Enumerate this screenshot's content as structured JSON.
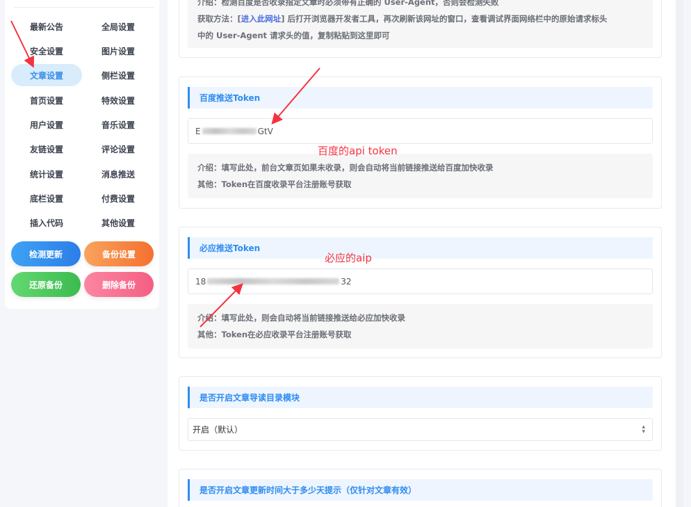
{
  "sidebar": {
    "items": [
      {
        "label": "最新公告"
      },
      {
        "label": "全局设置"
      },
      {
        "label": "安全设置"
      },
      {
        "label": "图片设置"
      },
      {
        "label": "文章设置",
        "active": true
      },
      {
        "label": "侧栏设置"
      },
      {
        "label": "首页设置"
      },
      {
        "label": "特效设置"
      },
      {
        "label": "用户设置"
      },
      {
        "label": "音乐设置"
      },
      {
        "label": "友链设置"
      },
      {
        "label": "评论设置"
      },
      {
        "label": "统计设置"
      },
      {
        "label": "消息推送"
      },
      {
        "label": "底栏设置"
      },
      {
        "label": "付费设置"
      },
      {
        "label": "插入代码"
      },
      {
        "label": "其他设置"
      }
    ],
    "buttons": {
      "check_update": "检测更新",
      "backup": "备份设置",
      "restore": "还原备份",
      "delete_backup": "删除备份"
    }
  },
  "top_card": {
    "intro": "介绍：检测百度是否收录指定文章时必须带有正确的 User-Agent，否则会检测失败",
    "method_prefix": "获取方法：[",
    "method_link": "进入此网址",
    "method_suffix": "] 后打开浏览器开发者工具，再次刷新该网址的窗口，查看调试界面网络栏中的原始请求标头",
    "method_line2": "中的 User-Agent 请求头的值，复制粘贴到这里即可"
  },
  "baidu_card": {
    "title": "百度推送Token",
    "value_start": "E",
    "value_end": "GtV",
    "intro": "介绍：填写此处，前台文章页如果未收录，则会自动将当前链接推送给百度加快收录",
    "other": "其他：Token在百度收录平台注册账号获取"
  },
  "bing_card": {
    "title": "必应推送Token",
    "value_start": "18",
    "value_end": "32",
    "intro": "介绍：填写此处，则会自动将当前链接推送给必应加快收录",
    "other": "其他：Token在必应收录平台注册账号获取"
  },
  "toc_card": {
    "title": "是否开启文章导读目录模块",
    "selected": "开启（默认）"
  },
  "update_card": {
    "title": "是否开启文章更新时间大于多少天提示（仅针对文章有效）"
  },
  "annotations": {
    "baidu": "百度的api token",
    "bing": "必应的aip"
  },
  "colors": {
    "accent": "#2e8cf0",
    "annotation": "#f5333f"
  }
}
